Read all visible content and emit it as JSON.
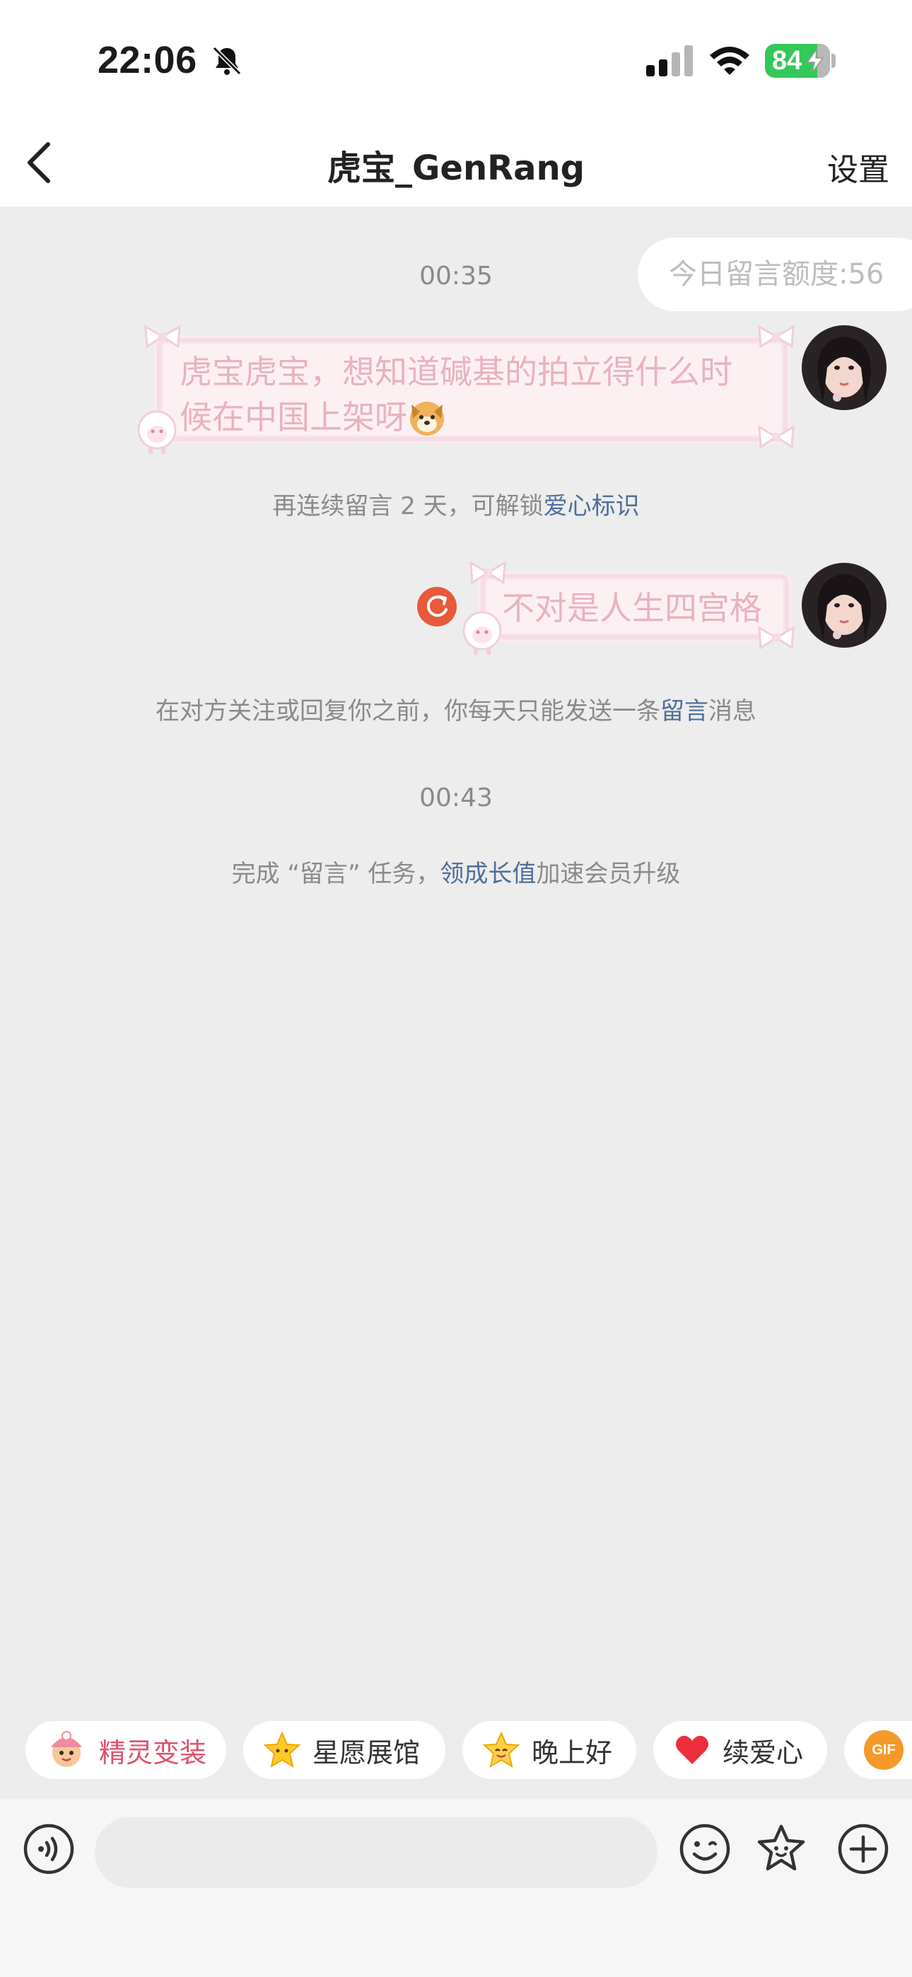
{
  "status_bar": {
    "time": "22:06",
    "battery": "84",
    "icons": [
      "bell-slash-icon",
      "signal-icon",
      "wifi-icon",
      "battery-charging-icon"
    ]
  },
  "nav": {
    "title": "虎宝_GenRang",
    "settings": "设置",
    "back_icon": "chevron-left-icon"
  },
  "quota": "今日留言额度:56",
  "messages": [
    {
      "time": "00:35",
      "text": "虎宝虎宝，想知道碱基的拍立得什么时候在中国上架呀",
      "line1": "虎宝虎宝，想知道碱基的拍立得什么时",
      "line2": "候在中国上架呀",
      "emoji": "dog-face-icon"
    },
    {
      "text": "不对是人生四宫格",
      "status": "resend-icon"
    }
  ],
  "notices": {
    "streak_prefix": "再连续留言 2 天，可解锁",
    "streak_link": "爱心标识",
    "limit_prefix": "在对方关注或回复你之前，你每天只能发送一条",
    "limit_link": "留言",
    "limit_suffix": "消息",
    "time2": "00:43",
    "task_prefix": "完成 “留言” 任务，",
    "task_link": "领成长值",
    "task_suffix": "加速会员升级"
  },
  "chips": [
    {
      "label": "精灵变装",
      "icon": "sprite-avatar-icon",
      "color": "#e0506c"
    },
    {
      "label": "星愿展馆",
      "icon": "star-icon",
      "color": "#333333"
    },
    {
      "label": "晚上好",
      "icon": "star-smile-icon",
      "color": "#333333"
    },
    {
      "label": "续爱心",
      "icon": "heart-icon",
      "color": "#333333"
    },
    {
      "label": "GIF",
      "icon": "gif-icon",
      "color": "#ffffff"
    }
  ],
  "input_bar": {
    "placeholder": "",
    "icons": [
      "voice-icon",
      "emoji-icon",
      "sticker-star-icon",
      "plus-icon"
    ]
  },
  "colors": {
    "link": "#4e6f9c",
    "bubble_text": "#e7b3c2",
    "background": "#ededed",
    "battery": "#34c759",
    "resend": "#e85a3a"
  }
}
